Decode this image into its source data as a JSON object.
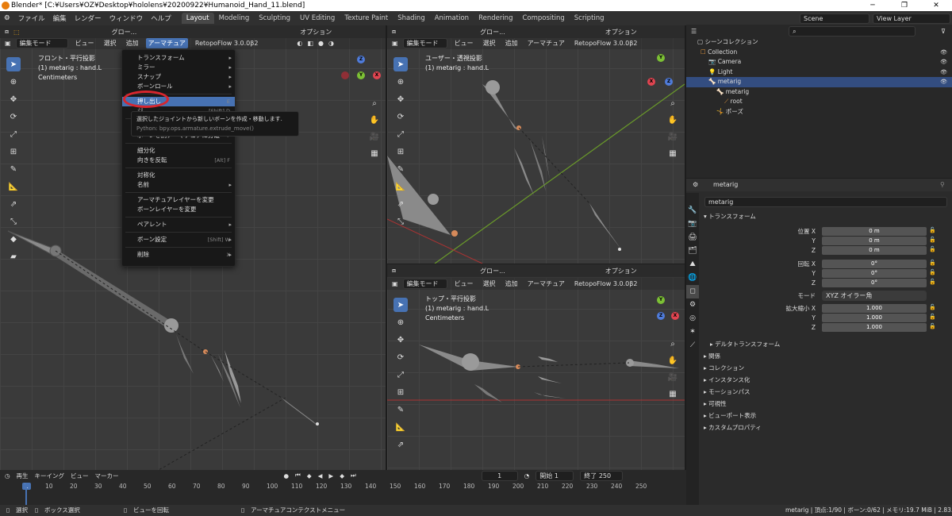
{
  "window": {
    "title": "Blender* [C:¥Users¥OZ¥Desktop¥hololens¥20200922¥Humanoid_Hand_11.blend]",
    "min": "─",
    "max": "❐",
    "close": "✕"
  },
  "menubar": {
    "items": [
      "ファイル",
      "編集",
      "レンダー",
      "ウィンドウ",
      "ヘルプ"
    ],
    "workspaces": [
      "Layout",
      "Modeling",
      "Sculpting",
      "UV Editing",
      "Texture Paint",
      "Shading",
      "Animation",
      "Rendering",
      "Compositing",
      "Scripting"
    ],
    "scene": "Scene",
    "view_layer": "View Layer"
  },
  "viewport_left": {
    "mode": "編集モード",
    "menu": [
      "ビュー",
      "選択",
      "追加",
      "アーマチュア"
    ],
    "addon": "RetopoFlow 3.0.0β2",
    "transform": "グロー...",
    "options": "オプション",
    "view_name": "フロント・平行投影",
    "object_info": "(1) metarig : hand.L",
    "units": "Centimeters"
  },
  "viewport_right_top": {
    "mode": "編集モード",
    "menu": [
      "ビュー",
      "選択",
      "追加",
      "アーマチュア"
    ],
    "addon": "RetopoFlow 3.0.0β2",
    "transform": "グロー...",
    "options": "オプション",
    "view_name": "ユーザー・透視投影",
    "object_info": "(1) metarig : hand.L",
    "units": "Centimeters"
  },
  "viewport_right_bottom": {
    "mode": "編集モード",
    "menu": [
      "ビュー",
      "選択",
      "追加",
      "アーマチュア"
    ],
    "addon": "RetopoFlow 3.0.0β2",
    "transform": "グロー...",
    "options": "オプション",
    "view_name": "トップ・平行投影",
    "object_info": "(1) metarig : hand.L",
    "units": "Centimeters"
  },
  "gizmo": {
    "x": "X",
    "y": "Y",
    "z": "Z"
  },
  "armature_menu": {
    "items": [
      {
        "label": "トランスフォーム",
        "shortcut": "",
        "submenu": true
      },
      {
        "label": "ミラー",
        "shortcut": "",
        "submenu": true
      },
      {
        "label": "スナップ",
        "shortcut": "",
        "submenu": true
      },
      {
        "label": "ボーンロール",
        "shortcut": "",
        "submenu": true
      },
      {
        "label": "押し出し",
        "shortcut": "E",
        "submenu": false
      },
      {
        "label": "ジ",
        "shortcut": "[Shift] D",
        "submenu": false
      },
      {
        "label": "分",
        "shortcut": "",
        "submenu": false
      },
      {
        "label": "ボーンを別アーマチュアに分離",
        "shortcut": "P",
        "submenu": false
      },
      {
        "label": "細分化",
        "shortcut": "",
        "submenu": false
      },
      {
        "label": "向きを反転",
        "shortcut": "[Alt] F",
        "submenu": false
      },
      {
        "label": "対称化",
        "shortcut": "",
        "submenu": false
      },
      {
        "label": "名前",
        "shortcut": "",
        "submenu": true
      },
      {
        "label": "アーマチュアレイヤーを変更",
        "shortcut": "",
        "submenu": false
      },
      {
        "label": "ボーンレイヤーを変更",
        "shortcut": "",
        "submenu": false
      },
      {
        "label": "ペアレント",
        "shortcut": "",
        "submenu": true
      },
      {
        "label": "ボーン設定",
        "shortcut": "[Shift] W",
        "submenu": true
      },
      {
        "label": "削除",
        "shortcut": "X",
        "submenu": true
      }
    ],
    "tooltip": "選択したジョイントから新しいボーンを作成・移動します.",
    "tooltip_python": "Python: bpy.ops.armature.extrude_move()"
  },
  "outliner": {
    "search_placeholder": "",
    "root": "シーンコレクション",
    "rows": [
      {
        "label": "Collection",
        "indent": 1
      },
      {
        "label": "Camera",
        "indent": 2
      },
      {
        "label": "Light",
        "indent": 2
      },
      {
        "label": "metarig",
        "indent": 2,
        "selected": true
      },
      {
        "label": "metarig",
        "indent": 3
      },
      {
        "label": "root",
        "indent": 4
      },
      {
        "label": "ポーズ",
        "indent": 3
      }
    ]
  },
  "properties": {
    "object_name": "metarig",
    "name_field": "metarig",
    "transform_header": "トランスフォーム",
    "location_label": "位置 X",
    "rotation_label": "回転 X",
    "scale_label": "拡大縮小 X",
    "axis_y": "Y",
    "axis_z": "Z",
    "location": [
      "0 m",
      "0 m",
      "0 m"
    ],
    "rotation": [
      "0°",
      "0°",
      "0°"
    ],
    "mode_label": "モード",
    "mode_value": "XYZ オイラー角",
    "scale": [
      "1.000",
      "1.000",
      "1.000"
    ],
    "delta": "デルタトランスフォーム",
    "sections": [
      "関係",
      "コレクション",
      "インスタンス化",
      "モーションパス",
      "可視性",
      "ビューポート表示",
      "カスタムプロパティ"
    ]
  },
  "timeline": {
    "menu": [
      "再生",
      "キーイング",
      "ビュー",
      "マーカー"
    ],
    "current_frame": "1",
    "start_label": "開始",
    "start": "1",
    "end_label": "終了",
    "end": "250",
    "ticks": [
      "1",
      "10",
      "20",
      "30",
      "40",
      "50",
      "60",
      "70",
      "80",
      "90",
      "100",
      "110",
      "120",
      "130",
      "140",
      "150",
      "160",
      "170",
      "180",
      "190",
      "200",
      "210",
      "220",
      "230",
      "240",
      "250"
    ]
  },
  "statusbar": {
    "select": "選択",
    "box_select": "ボックス選択",
    "rotate_view": "ビューを回転",
    "context_menu": "アーマチュアコンテクストメニュー",
    "stats": "metarig | 頂点:1/90 | ボーン:0/62 | メモリ:19.7 MiB | 2.83.0"
  }
}
